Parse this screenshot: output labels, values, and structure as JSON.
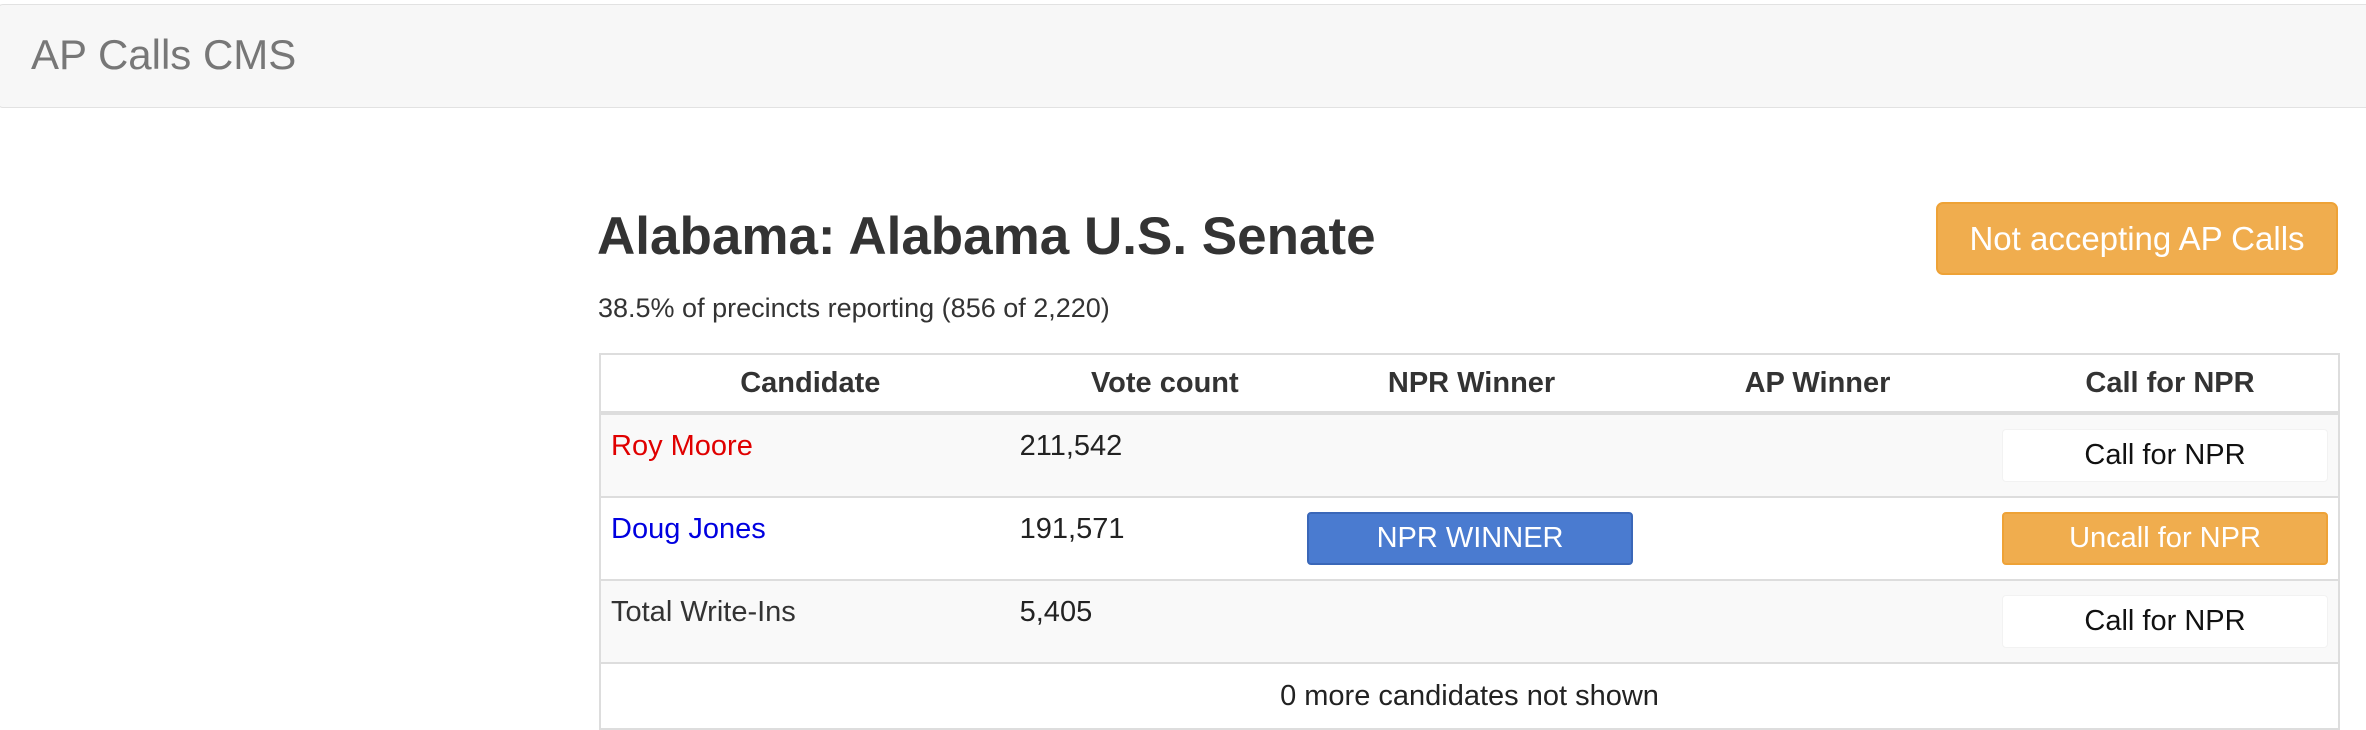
{
  "navbar": {
    "brand": "AP Calls CMS"
  },
  "race": {
    "title": "Alabama: Alabama U.S. Senate",
    "reporting": "38.5% of precincts reporting (856 of 2,220)",
    "ap_button_label": "Not accepting AP Calls"
  },
  "table": {
    "headers": [
      "Candidate",
      "Vote count",
      "NPR Winner",
      "AP Winner",
      "Call for NPR"
    ],
    "rows": [
      {
        "candidate": "Roy Moore",
        "votes": "211,542",
        "npr_winner": "",
        "ap_winner": "",
        "action": "Call for NPR"
      },
      {
        "candidate": "Doug Jones",
        "votes": "191,571",
        "npr_winner": "NPR WINNER",
        "ap_winner": "",
        "action": "Uncall for NPR"
      },
      {
        "candidate": "Total Write-Ins",
        "votes": "5,405",
        "npr_winner": "",
        "ap_winner": "",
        "action": "Call for NPR"
      }
    ],
    "footer": "0 more candidates not shown"
  },
  "colors": {
    "republican": "#e00000",
    "democrat": "#0000e0",
    "warning_orange": "#f0ad4e",
    "npr_winner_blue": "#4a7bd0"
  }
}
